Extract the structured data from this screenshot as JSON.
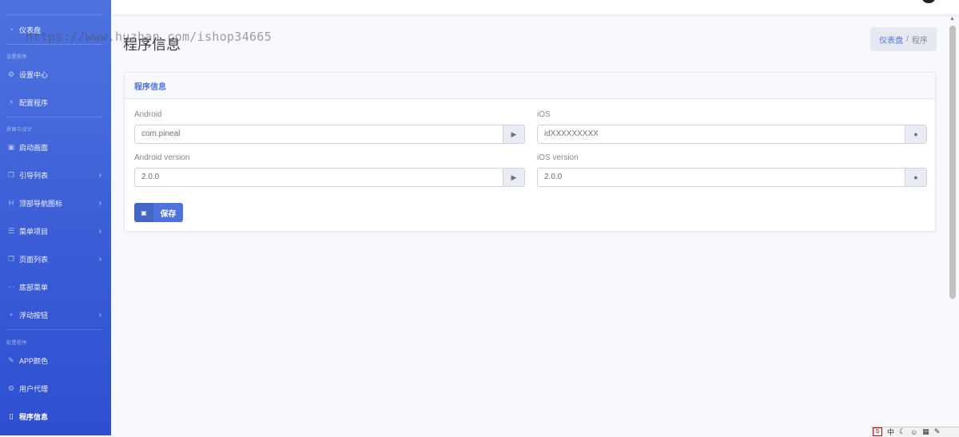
{
  "sidebar": {
    "dashboard": "仪表盘",
    "sections": [
      "设置程序",
      "界面与设计",
      "配置程序"
    ],
    "items": [
      {
        "label": "设置中心",
        "icon": "gears-icon"
      },
      {
        "label": "配置程序",
        "icon": "plug-icon"
      },
      {
        "label": "启动画面",
        "icon": "image-icon"
      },
      {
        "label": "引导列表",
        "icon": "copy-icon"
      },
      {
        "label": "顶部导航图标",
        "icon": "heading-icon"
      },
      {
        "label": "菜单项目",
        "icon": "list-icon"
      },
      {
        "label": "页面列表",
        "icon": "copy-icon"
      },
      {
        "label": "底部菜单",
        "icon": "ellipsis-icon"
      },
      {
        "label": "浮动按钮",
        "icon": "plus-icon"
      },
      {
        "label": "APP颜色",
        "icon": "wrench-icon"
      },
      {
        "label": "用户代理",
        "icon": "gears-icon"
      },
      {
        "label": "程序信息",
        "icon": "mobile-icon"
      }
    ]
  },
  "watermark": "https://www.huzhan.com/ishop34665",
  "page_title": "程序信息",
  "breadcrumb": {
    "home": "仪表盘",
    "separator": "/",
    "current": "程序"
  },
  "card": {
    "title": "程序信息",
    "android_label": "Android",
    "android_value": "com.pineal",
    "ios_label": "iOS",
    "ios_value": "idXXXXXXXXX",
    "android_version_label": "Android version",
    "android_version_value": "2.0.0",
    "ios_version_label": "iOS version",
    "ios_version_value": "2.0.0",
    "save_label": "保存"
  },
  "tray": {
    "ime": "中"
  },
  "colors": {
    "primary": "#4e73df",
    "sidebar_dark": "#2e4fd0",
    "background": "#f8f9fc"
  }
}
